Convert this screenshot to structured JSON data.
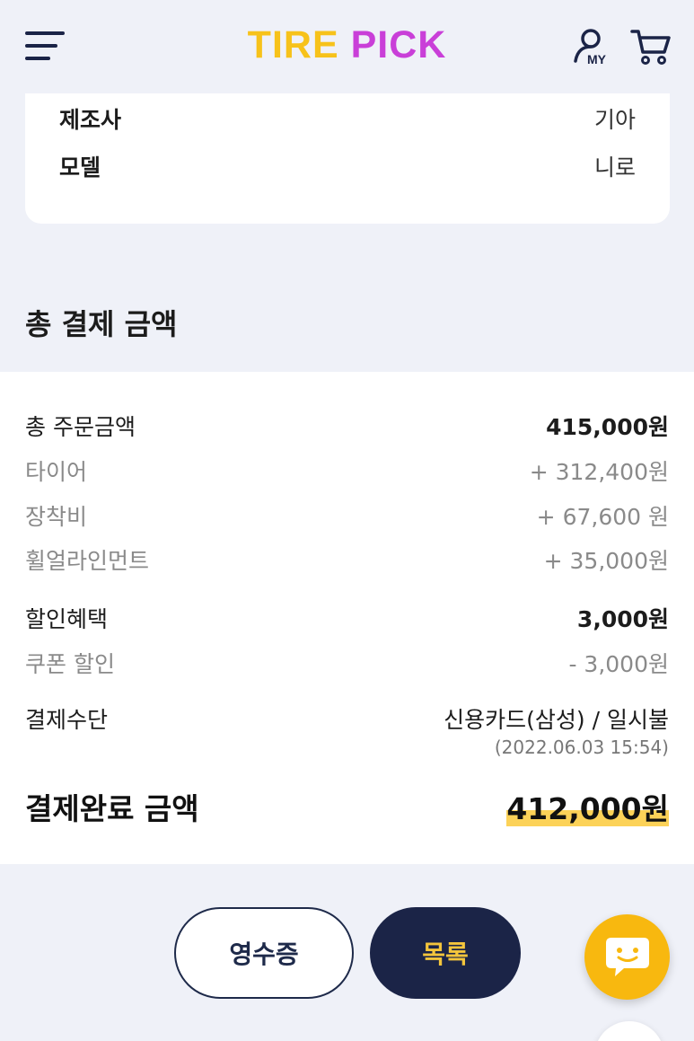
{
  "header": {
    "logo_part1": "TIRE",
    "logo_part2": "PICK",
    "my_label": "MY",
    "icons": [
      "menu-icon",
      "my-page-icon",
      "cart-icon"
    ]
  },
  "car_info": {
    "rows": [
      {
        "label": "제조사",
        "value": "기아"
      },
      {
        "label": "모델",
        "value": "니로"
      }
    ]
  },
  "payment": {
    "section_title": "총 결제 금액",
    "order_total_label": "총 주문금액",
    "order_total_value": "415,000원",
    "items": [
      {
        "label": "타이어",
        "value": "+ 312,400원"
      },
      {
        "label": "장착비",
        "value": "+ 67,600 원"
      },
      {
        "label": "휠얼라인먼트",
        "value": "+ 35,000원"
      }
    ],
    "discount_label": "할인혜택",
    "discount_value": "3,000원",
    "coupon_label": "쿠폰 할인",
    "coupon_value": "- 3,000원",
    "method_label": "결제수단",
    "method_value": "신용카드(삼성) / 일시불",
    "method_date": "(2022.06.03 15:54)",
    "final_label": "결제완료 금액",
    "final_value": "412,000원"
  },
  "buttons": {
    "receipt": "영수증",
    "list": "목록"
  },
  "colors": {
    "logo_yellow": "#f7c21a",
    "logo_purple": "#c93fd8",
    "navy": "#1b2447",
    "highlight": "#fcd258",
    "fab_yellow": "#f8b80f",
    "page_bg": "#eff1f8"
  }
}
